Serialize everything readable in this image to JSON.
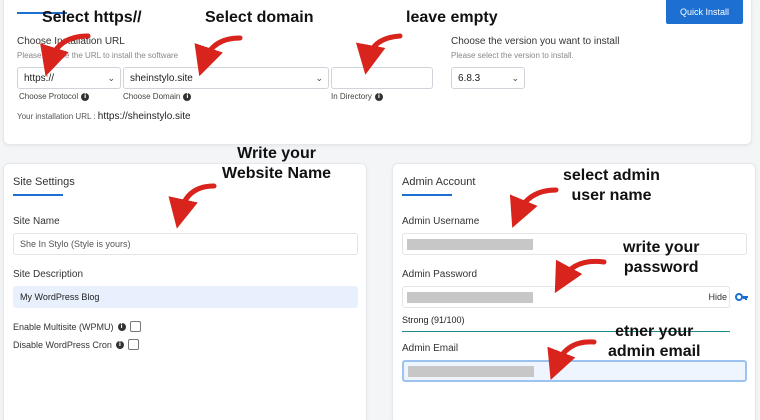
{
  "install": {
    "choose_url_label": "Choose Installation URL",
    "choose_url_hint": "Please choose the URL to install the software",
    "protocol_value": "https://",
    "domain_value": "sheinstylo.site",
    "directory_value": "",
    "protocol_caption": "Choose Protocol",
    "domain_caption": "Choose Domain",
    "directory_caption": "In Directory",
    "install_url_label": "Your installation URL :",
    "install_url_value": "https://sheinstylo.site",
    "version_label": "Choose the version you want to install",
    "version_hint": "Please select the version to install.",
    "version_value": "6.8.3",
    "quick_install": "Quick Install"
  },
  "site_settings": {
    "title": "Site Settings",
    "site_name_label": "Site Name",
    "site_name_value": "She In Stylo (Style is yours)",
    "site_desc_label": "Site Description",
    "site_desc_value": "My WordPress Blog",
    "multisite_label": "Enable Multisite (WPMU)",
    "cron_label": "Disable WordPress Cron"
  },
  "admin": {
    "title": "Admin Account",
    "username_label": "Admin Username",
    "password_label": "Admin Password",
    "hide_label": "Hide",
    "strength_label": "Strong (91/100)",
    "email_label": "Admin Email"
  },
  "annotations": {
    "select_https": "Select https//",
    "select_domain": "Select domain",
    "leave_empty": "leave empty",
    "write_name_1": "Write your",
    "write_name_2": "Website Name",
    "select_admin_1": "select admin",
    "select_admin_2": "user name",
    "write_pass_1": "write your",
    "write_pass_2": "password",
    "enter_email_1": "etner your",
    "enter_email_2": "admin email"
  },
  "colors": {
    "accent": "#1d6fd1",
    "arrow": "#d9231d",
    "strength_bar": "#1b8a8a"
  },
  "icons": {
    "info": "info-icon",
    "key": "key-icon",
    "chevron": "chevron-down-icon"
  }
}
